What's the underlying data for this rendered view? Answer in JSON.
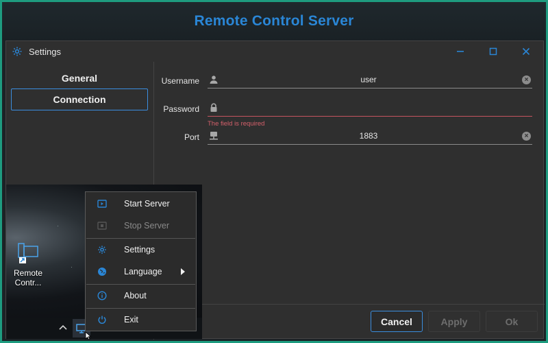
{
  "banner": {
    "title": "Remote Control Server"
  },
  "window": {
    "title": "Settings",
    "icons": {
      "app": "gear-icon",
      "minimize": "minimize-icon",
      "maximize": "maximize-icon",
      "close": "close-icon"
    },
    "accent_color": "#2a86d6"
  },
  "sidebar": {
    "items": [
      {
        "label": "General",
        "selected": false
      },
      {
        "label": "Connection",
        "selected": true
      }
    ]
  },
  "form": {
    "username": {
      "label": "Username",
      "value": "user",
      "icon": "user-icon"
    },
    "password": {
      "label": "Password",
      "value": "",
      "icon": "lock-icon",
      "error": "The field is required"
    },
    "port": {
      "label": "Port",
      "value": "1883",
      "icon": "network-icon"
    }
  },
  "buttons": {
    "cancel": "Cancel",
    "apply": "Apply",
    "ok": "Ok"
  },
  "desktop": {
    "icon_label_line1": "Remote",
    "icon_label_line2": "Contr..."
  },
  "context_menu": {
    "items": [
      {
        "label": "Start Server",
        "icon": "play-icon",
        "enabled": true
      },
      {
        "label": "Stop Server",
        "icon": "stop-icon",
        "enabled": false
      },
      {
        "label": "Settings",
        "icon": "gear-icon",
        "enabled": true
      },
      {
        "label": "Language",
        "icon": "globe-icon",
        "enabled": true,
        "submenu": true
      },
      {
        "label": "About",
        "icon": "info-icon",
        "enabled": true
      },
      {
        "label": "Exit",
        "icon": "power-icon",
        "enabled": true
      }
    ]
  }
}
